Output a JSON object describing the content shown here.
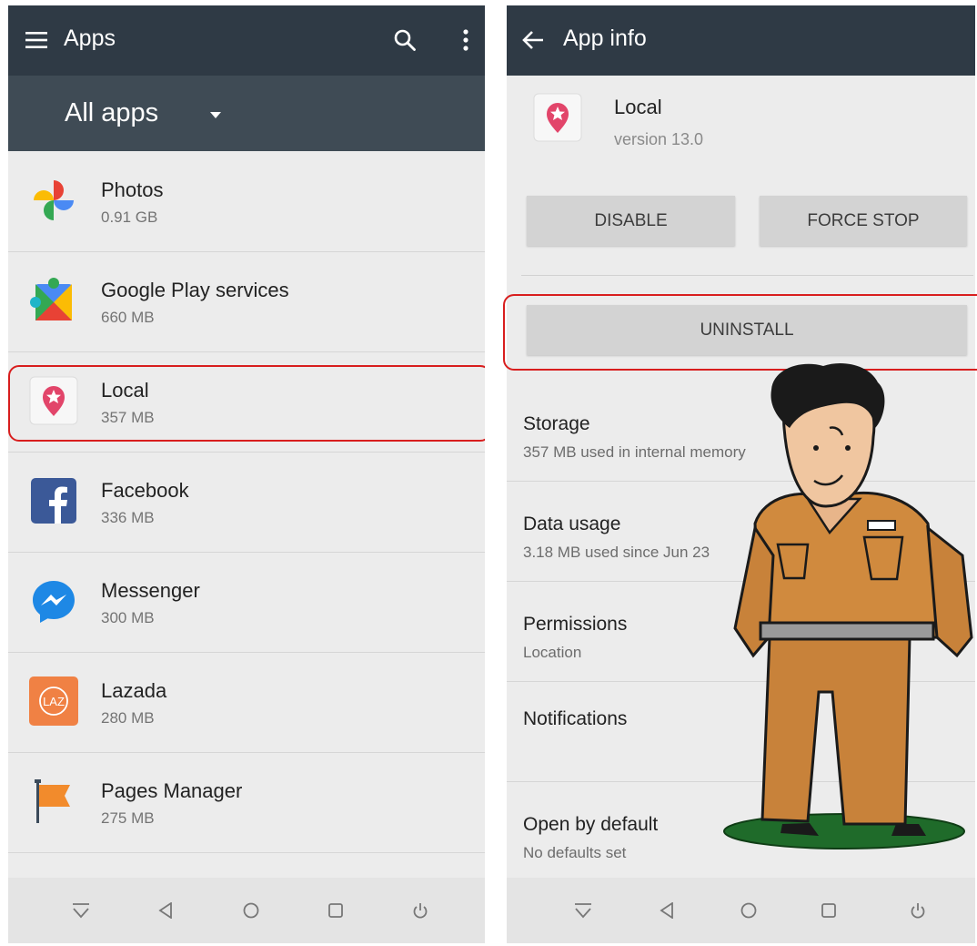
{
  "left_screen": {
    "toolbar": {
      "title": "Apps",
      "menu_icon": "hamburger-menu-icon",
      "search_icon": "search-icon",
      "overflow_icon": "more-vert-icon"
    },
    "filter": {
      "label": "All apps",
      "dropdown_icon": "dropdown-arrow-icon"
    },
    "apps": [
      {
        "name": "Photos",
        "size": "0.91 GB",
        "icon": "photos-pinwheel-icon"
      },
      {
        "name": "Google Play services",
        "size": "660 MB",
        "icon": "play-services-puzzle-icon"
      },
      {
        "name": "Local",
        "size": "357 MB",
        "icon": "local-pin-star-icon",
        "highlighted": true
      },
      {
        "name": "Facebook",
        "size": "336 MB",
        "icon": "facebook-icon"
      },
      {
        "name": "Messenger",
        "size": "300 MB",
        "icon": "messenger-icon"
      },
      {
        "name": "Lazada",
        "size": "280 MB",
        "icon": "lazada-icon",
        "icon_text": "LAZ"
      },
      {
        "name": "Pages Manager",
        "size": "275 MB",
        "icon": "pages-manager-flag-icon"
      }
    ]
  },
  "right_screen": {
    "toolbar": {
      "title": "App info",
      "back_icon": "back-arrow-icon"
    },
    "app": {
      "name": "Local",
      "version": "version 13.0",
      "icon": "local-pin-star-icon"
    },
    "buttons": {
      "disable": "DISABLE",
      "force_stop": "FORCE STOP",
      "uninstall": "UNINSTALL"
    },
    "sections": [
      {
        "title": "Storage",
        "subtitle": "357 MB used in internal memory"
      },
      {
        "title": "Data usage",
        "subtitle": "3.18 MB used since Jun 23"
      },
      {
        "title": "Permissions",
        "subtitle": "Location"
      },
      {
        "title": "Notifications",
        "subtitle": ""
      },
      {
        "title": "Open by default",
        "subtitle": "No defaults set"
      }
    ]
  },
  "navbar": {
    "icons": [
      "hide-bar-icon",
      "back-triangle-icon",
      "home-circle-icon",
      "recents-square-icon",
      "power-icon"
    ]
  },
  "colors": {
    "toolbar": "#2f3a45",
    "subbar": "#3f4b55",
    "highlight": "#d81e1e",
    "background": "#ececec",
    "button": "#d3d3d3"
  }
}
